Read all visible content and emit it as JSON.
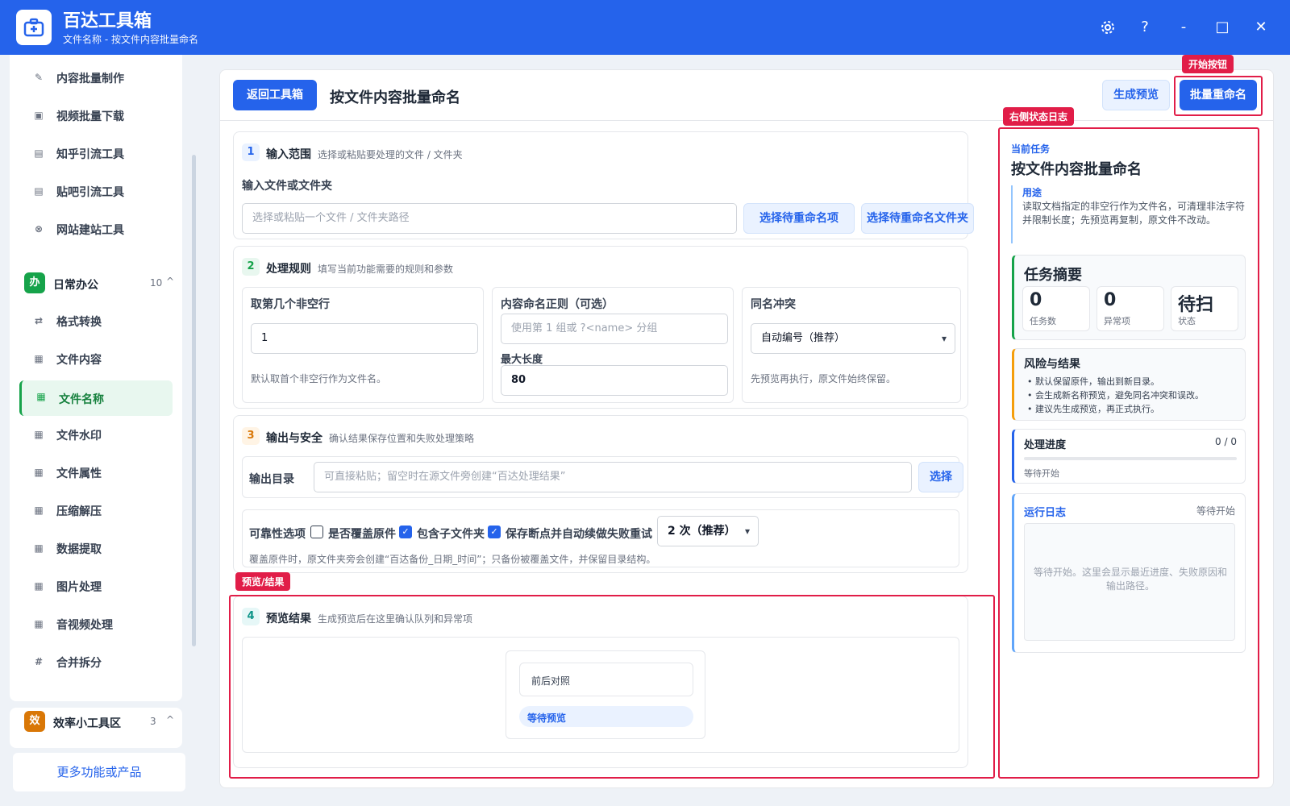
{
  "titlebar": {
    "title": "百达工具箱",
    "subtitle": "文件名称 - 按文件内容批量命名",
    "settings_icon": "gear-icon",
    "help_label": "?",
    "minimize_label": "-",
    "maximize_label": "□",
    "close_label": "✕"
  },
  "sidebar": {
    "top_items": [
      {
        "label": "内容批量制作",
        "icon": "pencil-icon"
      },
      {
        "label": "视频批量下载",
        "icon": "video-icon"
      },
      {
        "label": "知乎引流工具",
        "icon": "zhihu-icon"
      },
      {
        "label": "贴吧引流工具",
        "icon": "post-icon"
      },
      {
        "label": "网站建站工具",
        "icon": "globe-icon"
      }
    ],
    "group_office": {
      "badge": "办",
      "title": "日常办公",
      "count": "10",
      "toggle": "^",
      "items": [
        {
          "label": "格式转换",
          "icon": "swap-icon"
        },
        {
          "label": "文件内容",
          "icon": "grid-icon"
        },
        {
          "label": "文件名称",
          "icon": "grid-icon",
          "active": true
        },
        {
          "label": "文件水印",
          "icon": "grid-icon"
        },
        {
          "label": "文件属性",
          "icon": "grid-icon"
        },
        {
          "label": "压缩解压",
          "icon": "grid-icon"
        },
        {
          "label": "数据提取",
          "icon": "grid-icon"
        },
        {
          "label": "图片处理",
          "icon": "grid-icon"
        },
        {
          "label": "音视频处理",
          "icon": "grid-icon"
        },
        {
          "label": "合并拆分",
          "icon": "hash-icon"
        }
      ]
    },
    "group_efficiency": {
      "badge": "效",
      "title": "效率小工具区",
      "count": "3",
      "toggle": "^"
    },
    "more_link": "更多功能或产品"
  },
  "header": {
    "back_label": "返回工具箱",
    "page_title": "按文件内容批量命名",
    "preview_label": "生成预览",
    "rename_label": "批量重命名"
  },
  "section1": {
    "num": "1",
    "title": "输入范围",
    "desc": "选择或粘贴要处理的文件 / 文件夹",
    "field_label": "输入文件或文件夹",
    "input_placeholder": "选择或粘贴一个文件 / 文件夹路径",
    "choose_items_label": "选择待重命名项",
    "choose_folder_label": "选择待重命名文件夹"
  },
  "section2": {
    "num": "2",
    "title": "处理规则",
    "desc": "填写当前功能需要的规则和参数",
    "col1": {
      "label": "取第几个非空行",
      "value": "1",
      "hint": "默认取首个非空行作为文件名。"
    },
    "col2": {
      "label": "内容命名正则（可选）",
      "placeholder": "使用第 1 组或 ?<name> 分组",
      "max_label": "最大长度",
      "max_value": "80"
    },
    "col3": {
      "label": "同名冲突",
      "selected": "自动编号（推荐）",
      "hint": "先预览再执行，原文件始终保留。"
    }
  },
  "section3": {
    "num": "3",
    "title": "输出与安全",
    "desc": "确认结果保存位置和失败处理策略",
    "output_label": "输出目录",
    "output_placeholder": "可直接粘贴；留空时在源文件旁创建“百达处理结果”",
    "choose_label": "选择",
    "reliability_label": "可靠性选项",
    "opt_overwrite": "是否覆盖原件",
    "opt_subfolders": "包含子文件夹",
    "opt_resume": "保存断点并自动续做",
    "retry_label": "失败重试",
    "retry_selected": "2 次（推荐）",
    "note": "覆盖原件时，原文件夹旁会创建“百达备份_日期_时间”；只备份被覆盖文件，并保留目录结构。",
    "check_mark": "✓"
  },
  "section4": {
    "num": "4",
    "title": "预览结果",
    "desc": "生成预览后在这里确认队列和异常项",
    "compare_label": "前后对照",
    "pending_label": "等待预览"
  },
  "right_panel": {
    "current_task_label": "当前任务",
    "task_title": "按文件内容批量命名",
    "usage_label": "用途",
    "usage_text": "读取文档指定的非空行作为文件名，可清理非法字符并限制长度；先预览再复制，原文件不改动。",
    "summary_title": "任务摘要",
    "stats": [
      {
        "value": "0",
        "label": "任务数"
      },
      {
        "value": "0",
        "label": "异常项"
      },
      {
        "value": "待扫",
        "label": "状态"
      }
    ],
    "risk_title": "风险与结果",
    "risk_items": [
      "默认保留原件，输出到新目录。",
      "会生成新名称预览，避免同名冲突和误改。",
      "建议先生成预览，再正式执行。"
    ],
    "progress_title": "处理进度",
    "progress_count": "0 / 0",
    "progress_value": 0,
    "progress_status": "等待开始",
    "log_title": "运行日志",
    "log_status": "等待开始",
    "log_placeholder": "等待开始。这里会显示最近进度、失败原因和输出路径。"
  },
  "annotations": {
    "start_button": "开始按钮",
    "status_log": "右侧状态日志",
    "preview_result": "预览/结果"
  },
  "colors": {
    "brand": "#2563eb",
    "active_green": "#16a34a",
    "annotation_red": "#e11d48",
    "risk_orange": "#f59e0b"
  }
}
